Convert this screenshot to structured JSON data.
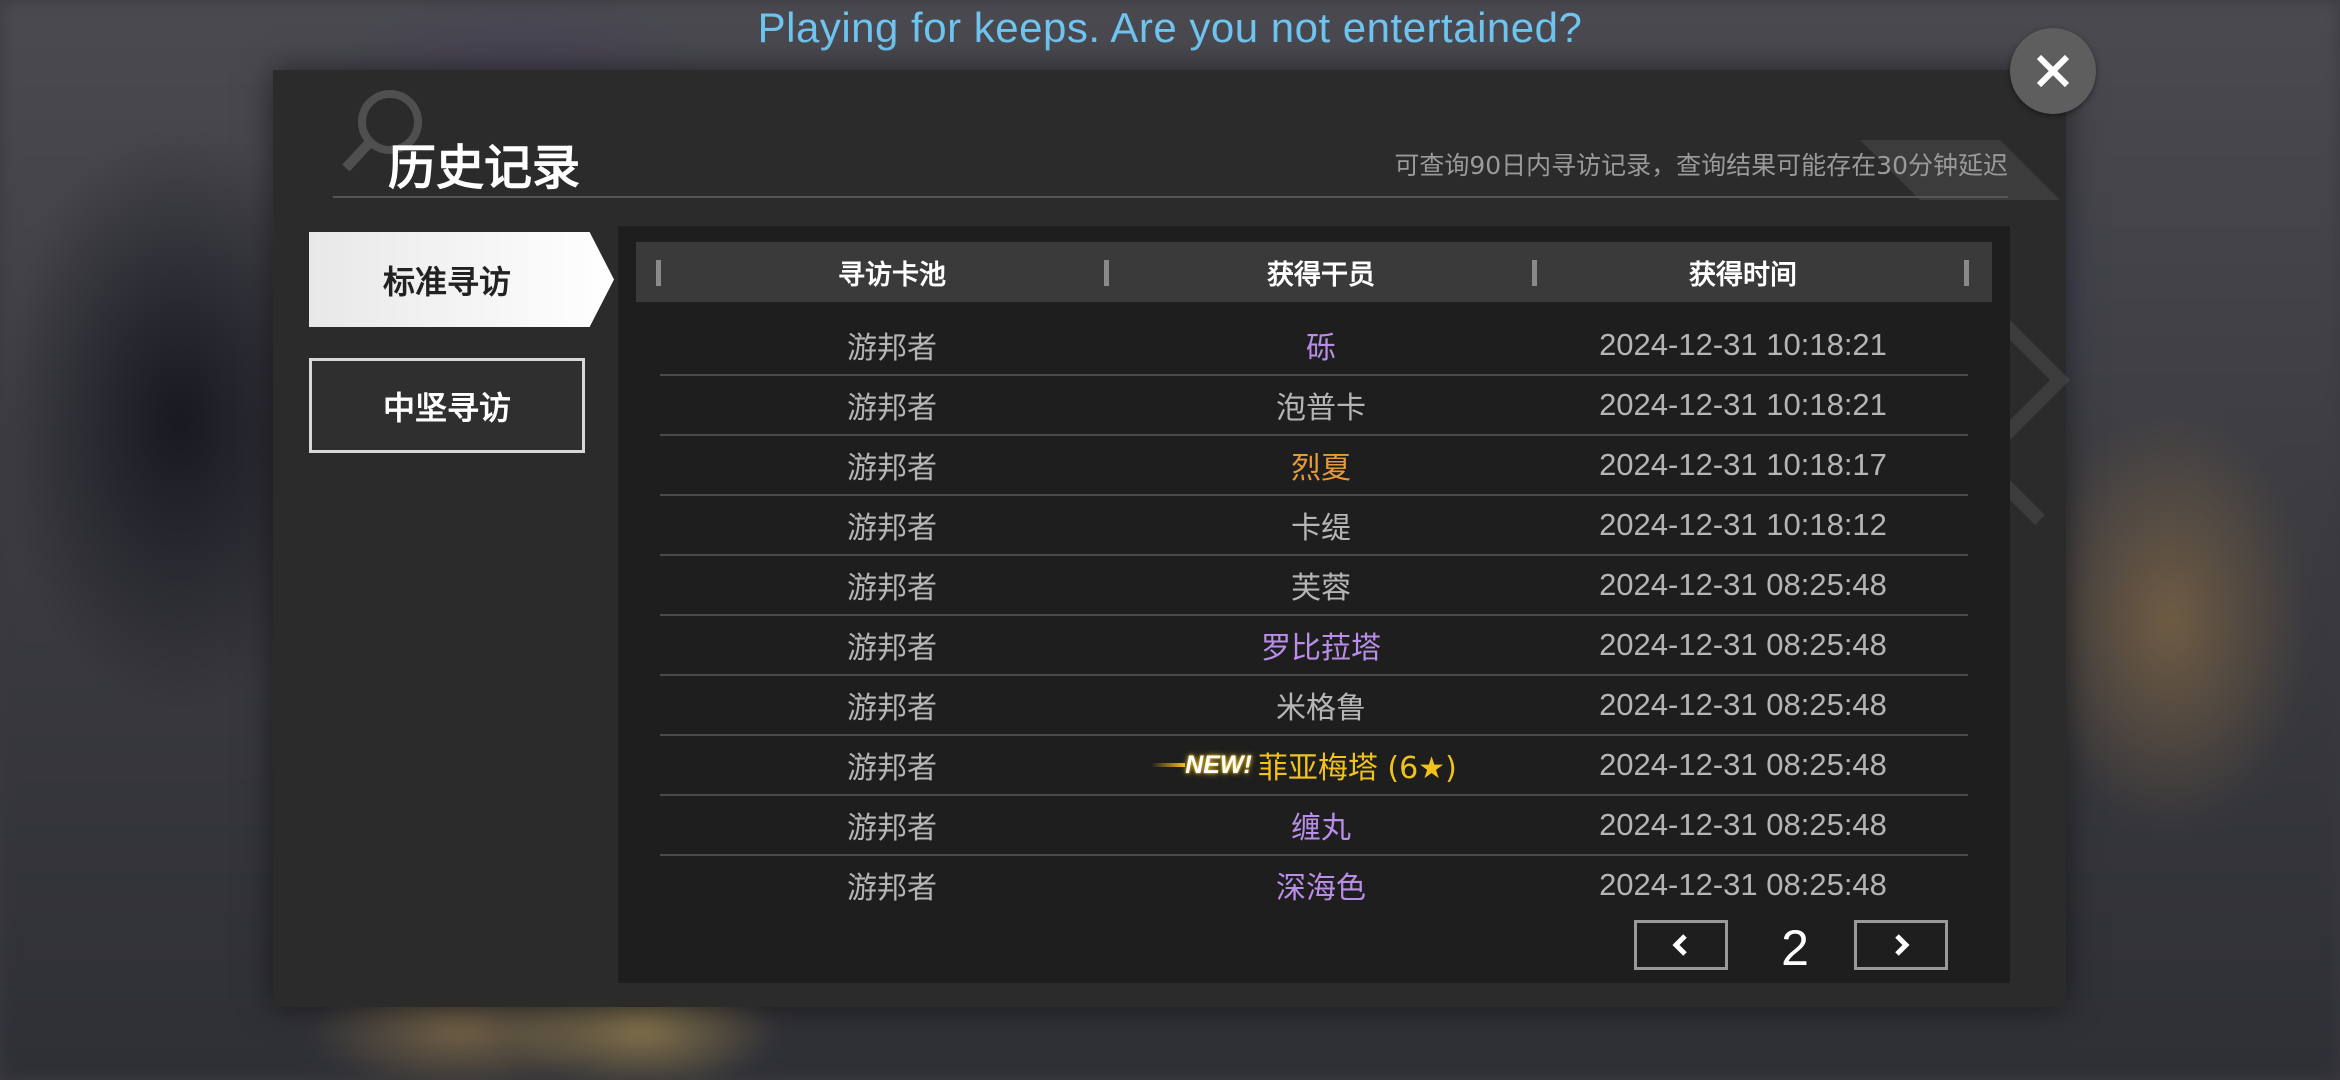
{
  "banner": "Playing for keeps.  Are you not entertained?",
  "dialog": {
    "title": "历史记录",
    "subtitle": "可查询90日内寻访记录，查询结果可能存在30分钟延迟"
  },
  "tabs": [
    {
      "label": "标准寻访",
      "active": true
    },
    {
      "label": "中坚寻访",
      "active": false
    }
  ],
  "table": {
    "headers": [
      "寻访卡池",
      "获得干员",
      "获得时间"
    ],
    "rows": [
      {
        "pool": "游邦者",
        "operator": "砾",
        "time": "2024-12-31 10:18:21",
        "color": "#b98ee8",
        "new": false
      },
      {
        "pool": "游邦者",
        "operator": "泡普卡",
        "time": "2024-12-31 10:18:21",
        "color": "#b5b5b5",
        "new": false
      },
      {
        "pool": "游邦者",
        "operator": "烈夏",
        "time": "2024-12-31 10:18:17",
        "color": "#e69a3a",
        "new": false
      },
      {
        "pool": "游邦者",
        "operator": "卡缇",
        "time": "2024-12-31 10:18:12",
        "color": "#b5b5b5",
        "new": false
      },
      {
        "pool": "游邦者",
        "operator": "芙蓉",
        "time": "2024-12-31 08:25:48",
        "color": "#b5b5b5",
        "new": false
      },
      {
        "pool": "游邦者",
        "operator": "罗比菈塔",
        "time": "2024-12-31 08:25:48",
        "color": "#b98ee8",
        "new": false
      },
      {
        "pool": "游邦者",
        "operator": "米格鲁",
        "time": "2024-12-31 08:25:48",
        "color": "#b5b5b5",
        "new": false
      },
      {
        "pool": "游邦者",
        "operator": "菲亚梅塔 (6★)",
        "time": "2024-12-31 08:25:48",
        "color": "#f2c21c",
        "new": true,
        "new_label": "NEW!"
      },
      {
        "pool": "游邦者",
        "operator": "缠丸",
        "time": "2024-12-31 08:25:48",
        "color": "#b98ee8",
        "new": false
      },
      {
        "pool": "游邦者",
        "operator": "深海色",
        "time": "2024-12-31 08:25:48",
        "color": "#b98ee8",
        "new": false
      }
    ]
  },
  "pager": {
    "page": "2"
  },
  "icons": {
    "close": "close-icon",
    "prev": "chevron-left-icon",
    "next": "chevron-right-icon"
  }
}
